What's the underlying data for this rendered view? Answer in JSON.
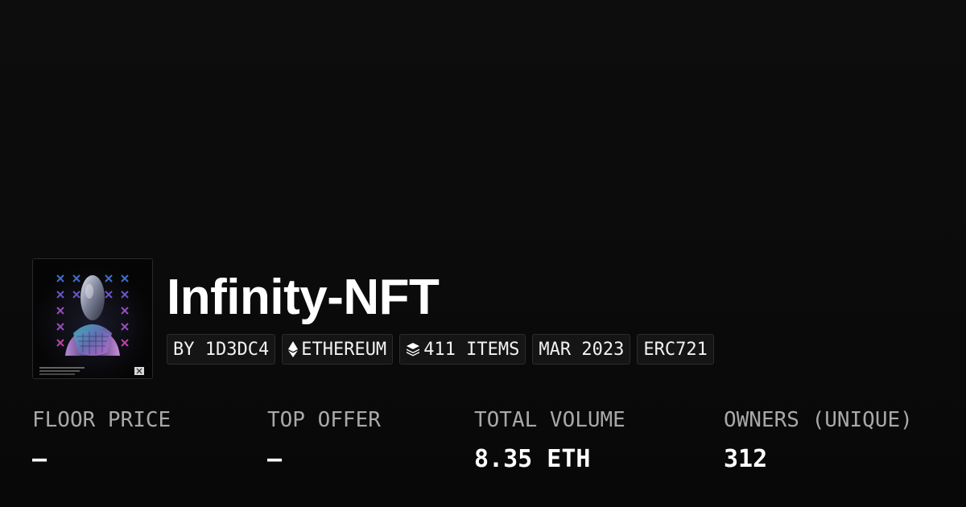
{
  "collection": {
    "name": "Infinity-NFT",
    "thumbnail_icon": "nft-artwork-hooded-figure",
    "tags": {
      "creator": "BY 1D3DC4",
      "chain": "ETHEREUM",
      "chain_icon": "ethereum-icon",
      "items": "411 ITEMS",
      "items_icon": "layers-icon",
      "date": "MAR 2023",
      "standard": "ERC721"
    }
  },
  "stats": {
    "floor_price": {
      "label": "FLOOR PRICE",
      "value": "—"
    },
    "top_offer": {
      "label": "TOP OFFER",
      "value": "—"
    },
    "total_volume": {
      "label": "TOTAL VOLUME",
      "value": "8.35 ETH"
    },
    "owners": {
      "label": "OWNERS (UNIQUE)",
      "value": "312"
    }
  },
  "colors": {
    "background": "#0a0a0a",
    "tag_background": "#151515",
    "label_gray": "#a8a8a8",
    "text": "#ffffff"
  }
}
